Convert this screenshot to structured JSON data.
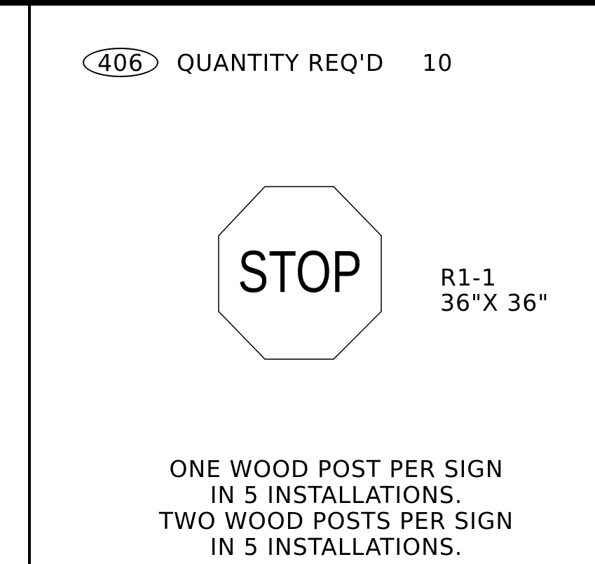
{
  "item": {
    "number": "406",
    "quantity_label": "QUANTITY REQ'D",
    "quantity_value": "10"
  },
  "sign": {
    "legend": "STOP",
    "code": "R1-1",
    "size": "36\"X 36\""
  },
  "notes": [
    "ONE WOOD POST PER SIGN",
    "IN 5 INSTALLATIONS.",
    "TWO WOOD POSTS PER SIGN",
    "IN 5 INSTALLATIONS."
  ]
}
